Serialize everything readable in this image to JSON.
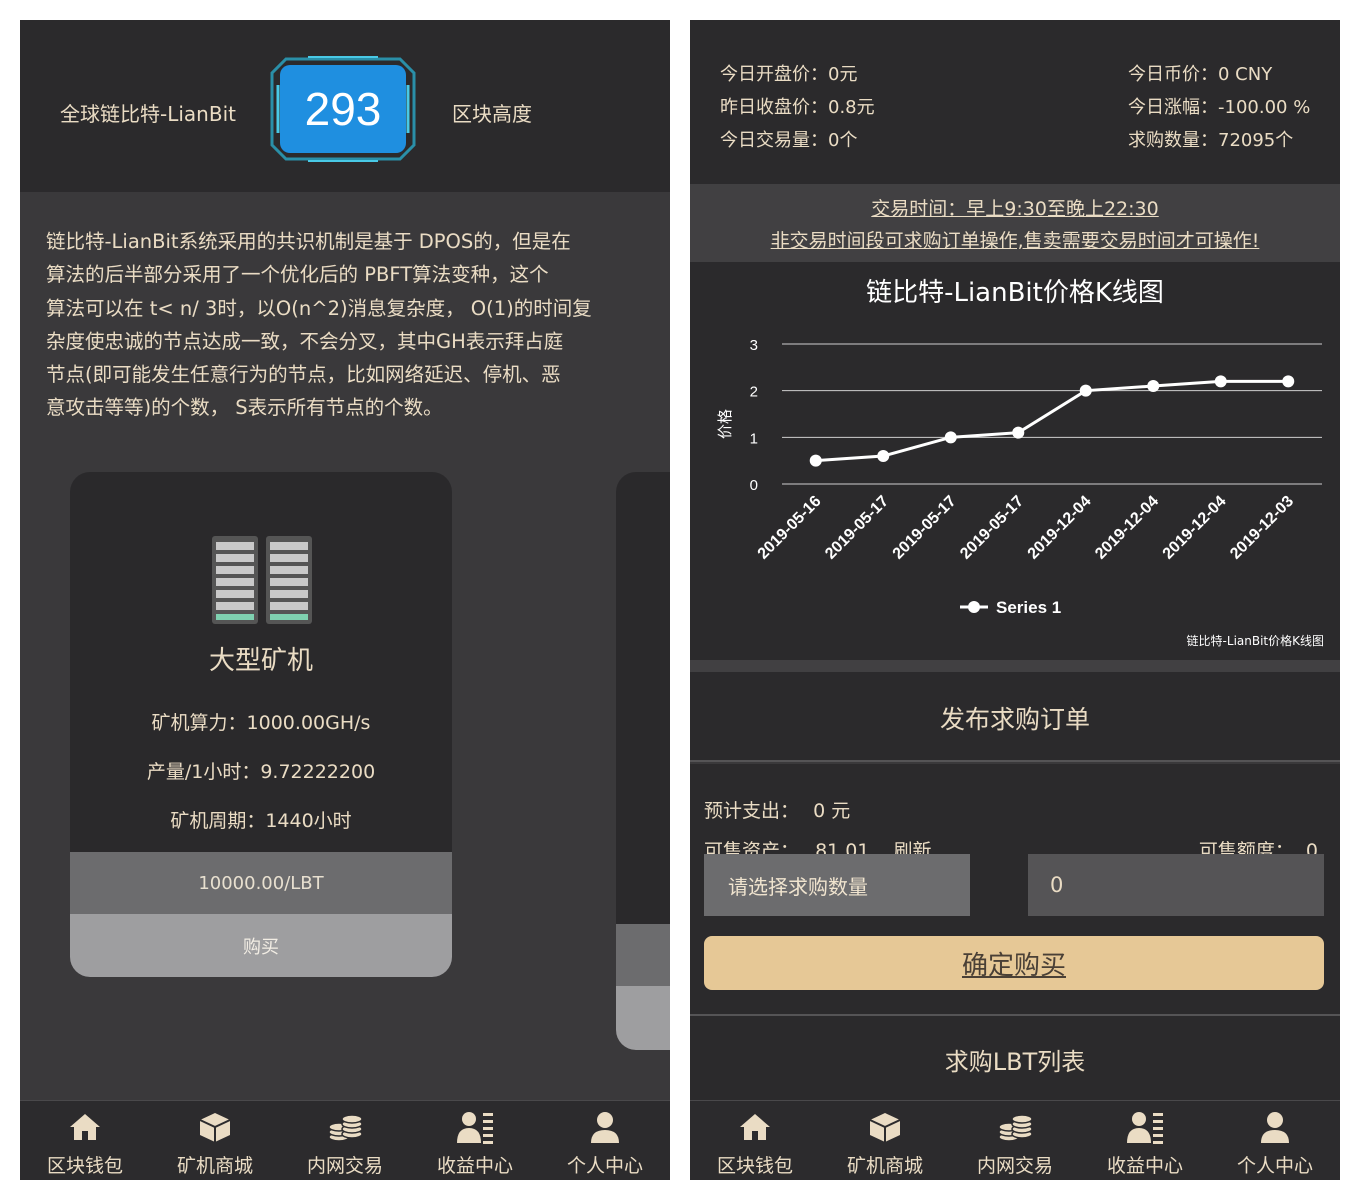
{
  "left": {
    "header": {
      "name": "全球链比特-LianBit",
      "block_height": "293",
      "block_height_label": "区块高度"
    },
    "intro_lines": [
      "链比特-LianBit系统采用的共识机制是基于 DPOS的，但是在",
      "算法的后半部分采用了一个优化后的 PBFT算法变种，这个",
      "算法可以在 t< n/ 3时，以O(n^2)消息复杂度， O(1)的时间复",
      "杂度使忠诚的节点达成一致，不会分叉，其中GH表示拜占庭",
      "节点(即可能发生任意行为的节点，比如网络延迟、停机、恶",
      "意攻击等等)的个数， S表示所有节点的个数。"
    ],
    "miner_card": {
      "title": "大型矿机",
      "hashrate": "矿机算力：1000.00GH/s",
      "output": "产量/1小时：9.72222200",
      "cycle": "矿机周期：1440小时",
      "price": "10000.00/LBT",
      "buy_label": "购买"
    }
  },
  "right": {
    "header": {
      "open_price": "今日开盘价：0元",
      "prev_close": "昨日收盘价：0.8元",
      "volume": "今日交易量：0个",
      "coin_price": "今日币价：0 CNY",
      "change": "今日涨幅：-100.00 %",
      "bid_count": "求购数量：72095个"
    },
    "trading": {
      "time": "交易时间：早上9:30至晚上22:30",
      "note": "非交易时间段可求购订单操作,售卖需要交易时间才可操作!"
    },
    "chart_credit": "链比特-LianBit价格K线图",
    "order": {
      "title": "发布求购订单",
      "estimated_label": "预计支出：",
      "estimated_value": "0 元",
      "assets_label": "可售资产：",
      "assets_value": "81.01",
      "refresh_label": "刷新",
      "quota_label": "可售额度：",
      "quota_value": "0",
      "select_placeholder": "请选择求购数量",
      "amount_value": "0",
      "confirm_label": "确定购买"
    },
    "list_title": "求购LBT列表"
  },
  "nav": [
    {
      "label": "区块钱包",
      "icon": "home-icon"
    },
    {
      "label": "矿机商城",
      "icon": "box-icon"
    },
    {
      "label": "内网交易",
      "icon": "coins-icon"
    },
    {
      "label": "收益中心",
      "icon": "user-list-icon"
    },
    {
      "label": "个人中心",
      "icon": "user-icon"
    }
  ],
  "colors": {
    "background": "#3a393b",
    "panel": "#2b2a2c",
    "text": "#eadcc4",
    "block_badge": "#1f8fe0",
    "confirm_button": "#e6c896"
  },
  "chart_data": {
    "type": "line",
    "title": "链比特-LianBit价格K线图",
    "ylabel": "价格",
    "xlabel": "",
    "ylim": [
      0,
      3
    ],
    "yticks": [
      "0",
      "1",
      "2",
      "3"
    ],
    "categories": [
      "2019-05-16",
      "2019-05-17",
      "2019-05-17",
      "2019-05-17",
      "2019-12-04",
      "2019-12-04",
      "2019-12-04",
      "2019-12-03"
    ],
    "series": [
      {
        "name": "Series 1",
        "values": [
          0.5,
          0.6,
          1.0,
          1.1,
          2.0,
          2.1,
          2.2,
          2.2
        ]
      }
    ],
    "grid": true,
    "legend": "bottom"
  }
}
